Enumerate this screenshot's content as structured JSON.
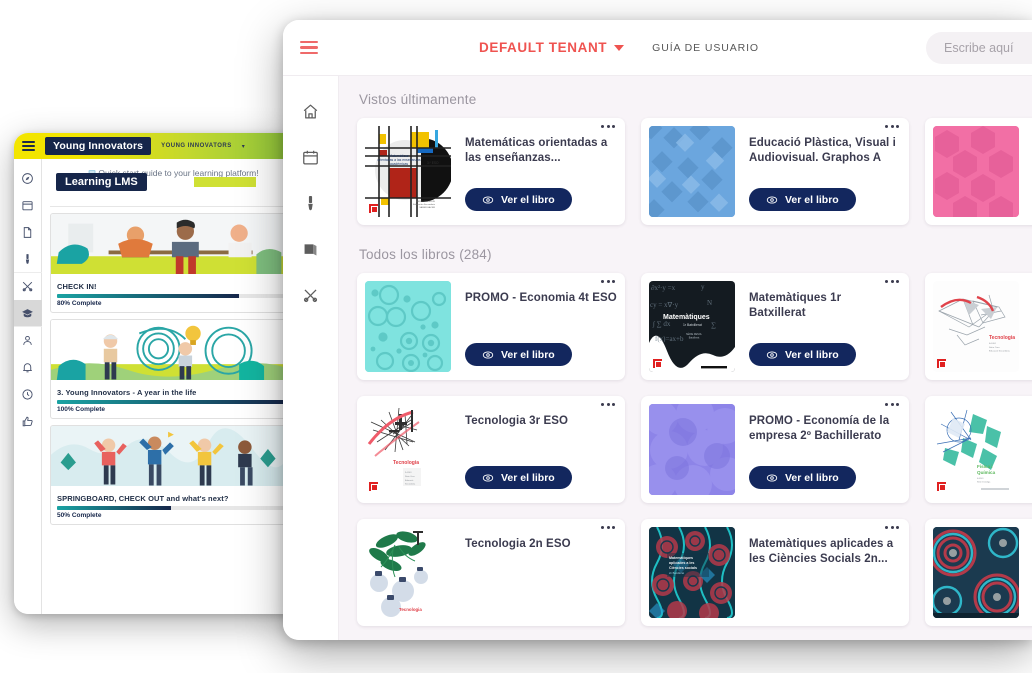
{
  "back_window": {
    "brand_badge": "Young Innovators",
    "tenant": "YOUNG INNOVATORS",
    "caret": "▾",
    "quick_start": "Quick start guide to your learning platform!",
    "platform_badge": "Learning LMS",
    "rail_icons": [
      "compass-icon",
      "calendar-icon",
      "file-icon",
      "brush-icon",
      "tools-icon",
      "graduation-cap-icon",
      "user-icon",
      "bell-icon",
      "clock-icon",
      "thumbs-up-icon"
    ],
    "courses": [
      {
        "title": "CHECK IN!",
        "progress_label": "80% Complete",
        "progress": 80
      },
      {
        "title": "3. Young Innovators - A year in the life",
        "progress_label": "100% Complete",
        "progress": 100
      },
      {
        "title": "SPRINGBOARD, CHECK OUT and what's next?",
        "progress_label": "50% Complete",
        "progress": 50
      }
    ]
  },
  "front_window": {
    "tenant_selector": "DEFAULT TENANT",
    "user_guide": "GUÍA DE USUARIO",
    "search_placeholder": "Escribe aquí",
    "rail_icons": [
      "home-icon",
      "calendar-icon",
      "brush-icon",
      "book-icon",
      "tools-icon"
    ],
    "sections": [
      {
        "id": "recent",
        "title": "Vistos últimamente"
      },
      {
        "id": "all",
        "title": "Todos los libros (284)"
      }
    ],
    "view_button_label": "Ver el libro",
    "recent_books": [
      {
        "title": "Matemáticas orientadas a las enseñanzas...",
        "cover": "mondrian"
      },
      {
        "title": "Educació Plàstica, Visual i Audiovisual. Graphos A",
        "cover": "blue-diamonds"
      },
      {
        "title": "",
        "cover": "pink-hex"
      }
    ],
    "all_books": [
      {
        "title": "PROMO - Economia 4t ESO",
        "cover": "teal-circles"
      },
      {
        "title": "Matemàtiques 1r Batxillerat",
        "cover": "chalkboard"
      },
      {
        "title": "",
        "cover": "white-plane"
      },
      {
        "title": "Tecnologia 3r ESO",
        "cover": "white-scribble"
      },
      {
        "title": "PROMO - Economía de la empresa 2º Bachillerato",
        "cover": "purple-circles"
      },
      {
        "title": "",
        "cover": "white-flower"
      },
      {
        "title": "Tecnologia 2n ESO",
        "cover": "white-leaves"
      },
      {
        "title": "Matemàtiques aplicades a les Ciències Socials 2n...",
        "cover": "mandala"
      },
      {
        "title": "",
        "cover": "mandala2"
      }
    ]
  },
  "colors": {
    "accent_red": "#ef5350",
    "button_navy": "#13275e",
    "page_bg": "#f8f4f8",
    "lms_yellow": "#f3e500",
    "lms_green": "#8cc63f",
    "lms_navy": "#16264a",
    "progress_teal": "#1aa3a3"
  }
}
